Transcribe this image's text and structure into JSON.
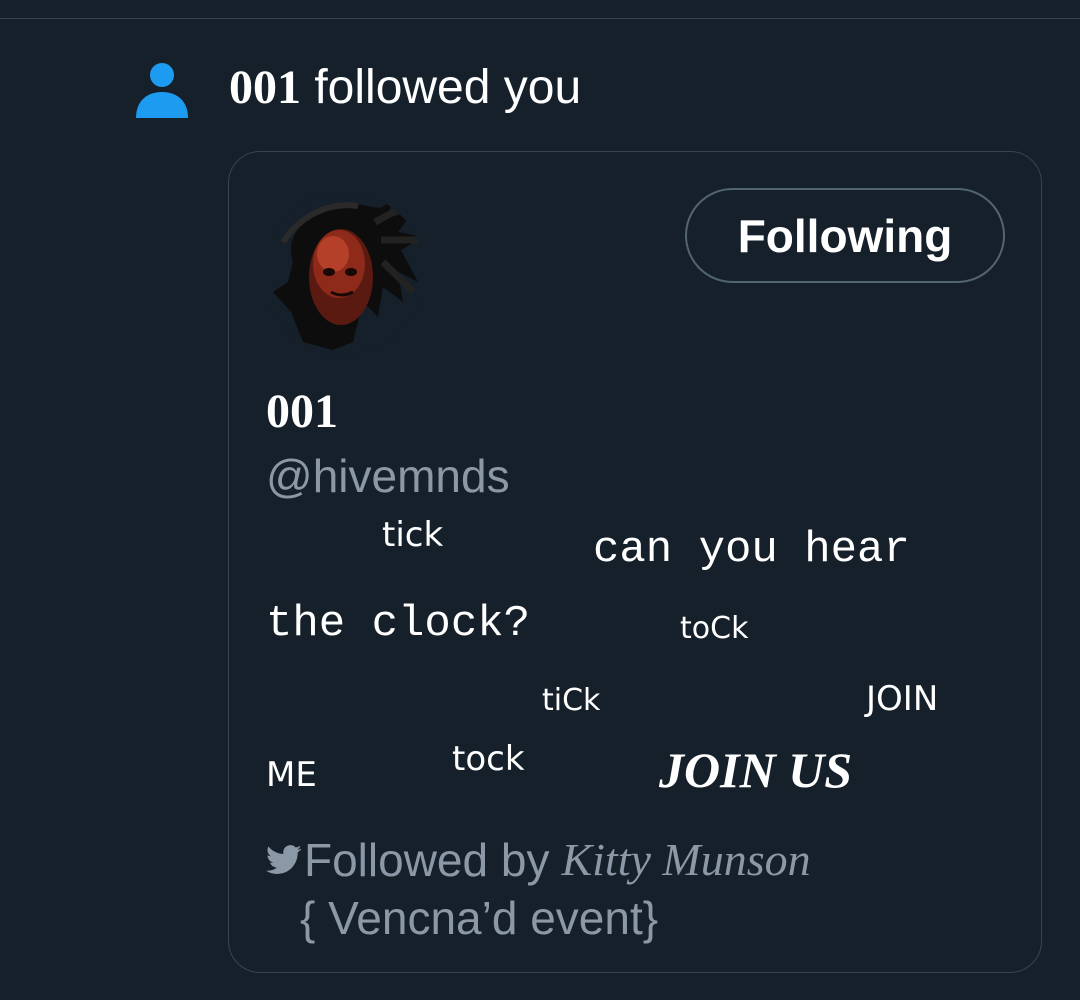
{
  "notification": {
    "actor_name": "001",
    "action_text": " followed you",
    "icon": "person-icon",
    "icon_color": "#1d9bf0"
  },
  "card": {
    "avatar": "avatar-image",
    "follow_button_label": "Following",
    "display_name": "001",
    "handle": "@hivemnds",
    "bio_fragments": {
      "tick1": "tick",
      "can_you_hear": "can you hear",
      "the_clock": "the clock?",
      "tock1": "toCk",
      "tick2": "tiCk",
      "join": "JOIN",
      "me": "ME",
      "tock2": "tock",
      "join_us": "JOIN US"
    },
    "followed_by_prefix": "Followed by",
    "followed_by_name": "Kitty Munson",
    "followed_by_suffix": "{ Vencna’d event}",
    "bird_icon": "bird-icon"
  },
  "colors": {
    "background": "#15202b",
    "border": "#38444d",
    "secondary_text": "#8b98a5",
    "accent": "#1d9bf0"
  }
}
